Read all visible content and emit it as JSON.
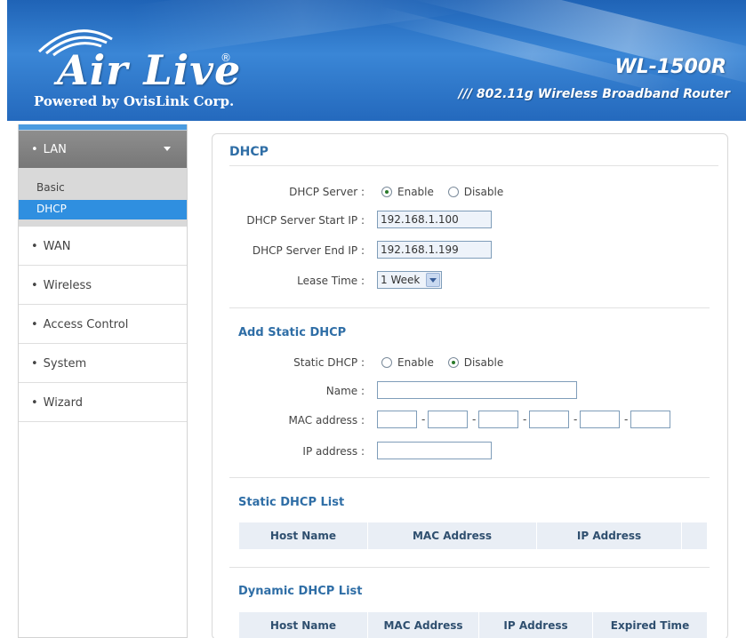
{
  "header": {
    "logo_main": "Air Live",
    "logo_reg": "®",
    "logo_sub": "Powered by OvisLink Corp.",
    "model": "WL-1500R",
    "tagline": "/// 802.11g Wireless Broadband Router"
  },
  "sidebar": {
    "bullet": "•",
    "lan": "LAN",
    "lan_sub": [
      "Basic",
      "DHCP"
    ],
    "items": [
      "WAN",
      "Wireless",
      "Access Control",
      "System",
      "Wizard"
    ]
  },
  "dhcp": {
    "title": "DHCP",
    "server_label": "DHCP Server :",
    "enable": "Enable",
    "disable": "Disable",
    "start_label": "DHCP Server Start IP :",
    "start_value": "192.168.1.100",
    "end_label": "DHCP Server End IP :",
    "end_value": "192.168.1.199",
    "lease_label": "Lease Time :",
    "lease_value": "1 Week"
  },
  "static": {
    "title": "Add Static DHCP",
    "static_label": "Static DHCP :",
    "enable": "Enable",
    "disable": "Disable",
    "name_label": "Name :",
    "mac_label": "MAC address :",
    "mac_sep": "-",
    "ip_label": "IP address :"
  },
  "static_list": {
    "title": "Static DHCP List",
    "columns": [
      "Host Name",
      "MAC Address",
      "IP Address"
    ]
  },
  "dynamic_list": {
    "title": "Dynamic DHCP List",
    "columns": [
      "Host Name",
      "MAC Address",
      "IP Address",
      "Expired Time"
    ]
  }
}
